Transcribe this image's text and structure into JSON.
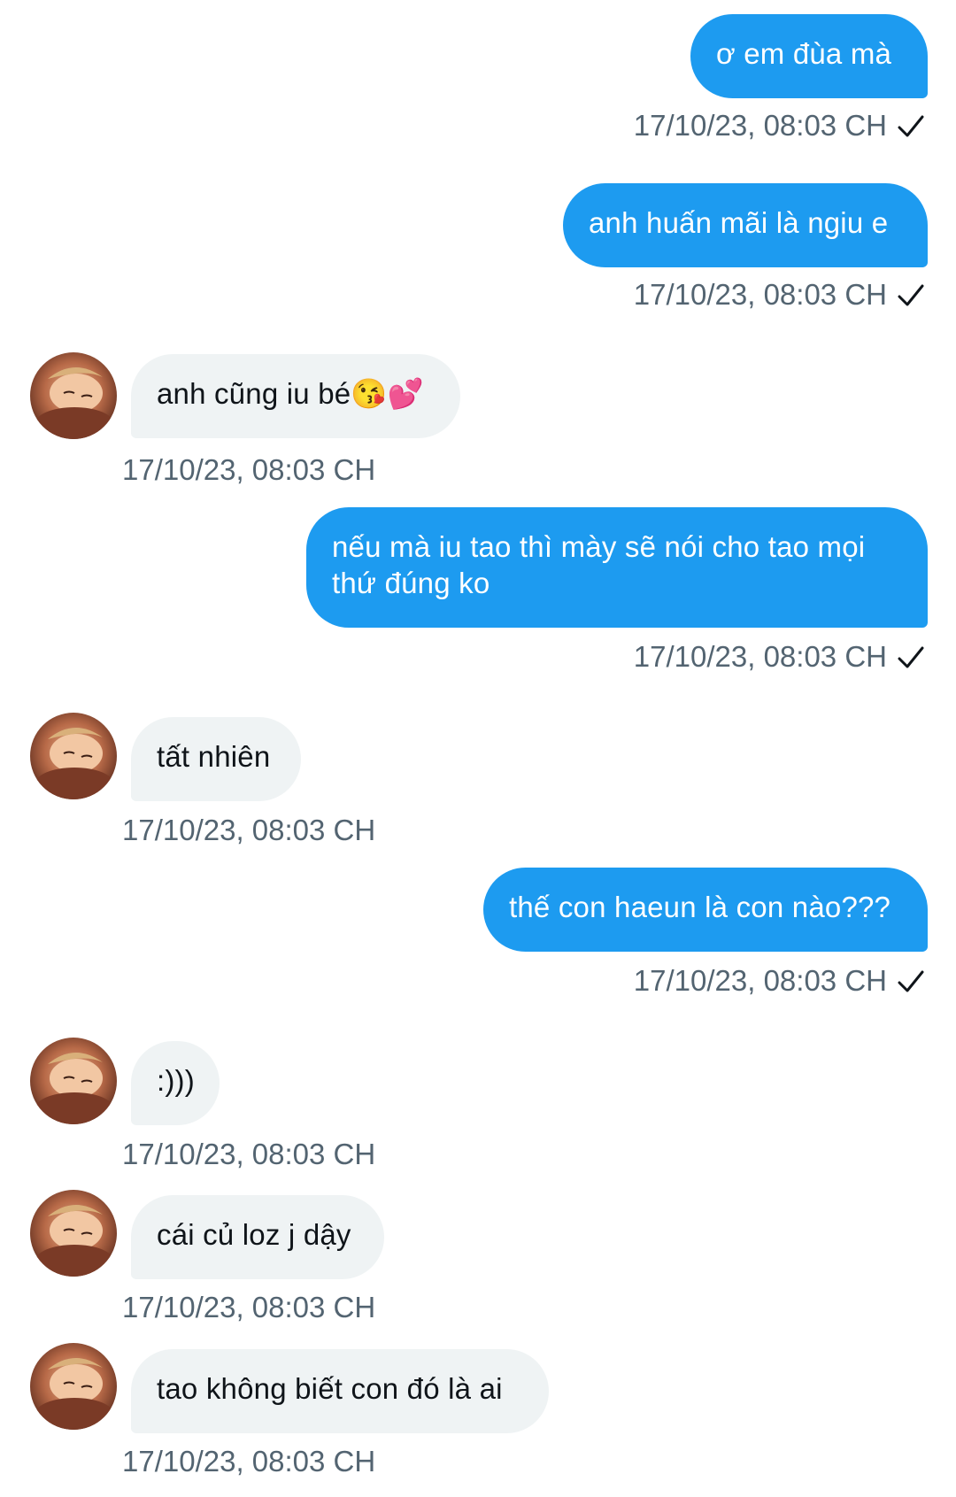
{
  "conversation": {
    "messages": [
      {
        "direction": "outgoing",
        "text": "ơ em đùa mà",
        "time": "17/10/23, 08:03 CH",
        "status_icon": "check-icon"
      },
      {
        "direction": "outgoing",
        "text": "anh huấn mãi là ngiu e",
        "time": "17/10/23, 08:03 CH",
        "status_icon": "check-icon"
      },
      {
        "direction": "incoming",
        "text": "anh cũng iu bé😘💕",
        "time": "17/10/23, 08:03 CH",
        "avatar_icon": "contact-avatar"
      },
      {
        "direction": "outgoing",
        "text": "nếu mà iu tao thì mày sẽ nói cho tao mọi thứ đúng ko",
        "time": "17/10/23, 08:03 CH",
        "status_icon": "check-icon"
      },
      {
        "direction": "incoming",
        "text": "tất nhiên",
        "time": "17/10/23, 08:03 CH",
        "avatar_icon": "contact-avatar"
      },
      {
        "direction": "outgoing",
        "text": "thế con haeun là con nào???",
        "time": "17/10/23, 08:03 CH",
        "status_icon": "check-icon"
      },
      {
        "direction": "incoming",
        "text": ":)))",
        "time": "17/10/23, 08:03 CH",
        "avatar_icon": "contact-avatar"
      },
      {
        "direction": "incoming",
        "text": "cái củ loz j dậy",
        "time": "17/10/23, 08:03 CH",
        "avatar_icon": "contact-avatar"
      },
      {
        "direction": "incoming",
        "text": "tao không biết con đó là ai",
        "time": "17/10/23, 08:03 CH",
        "avatar_icon": "contact-avatar"
      }
    ]
  },
  "colors": {
    "outgoing_bubble": "#1d9bf0",
    "incoming_bubble": "#eff3f4",
    "outgoing_text": "#ffffff",
    "incoming_text": "#0f1419",
    "timestamp": "#536471",
    "check": "#0f1419"
  }
}
